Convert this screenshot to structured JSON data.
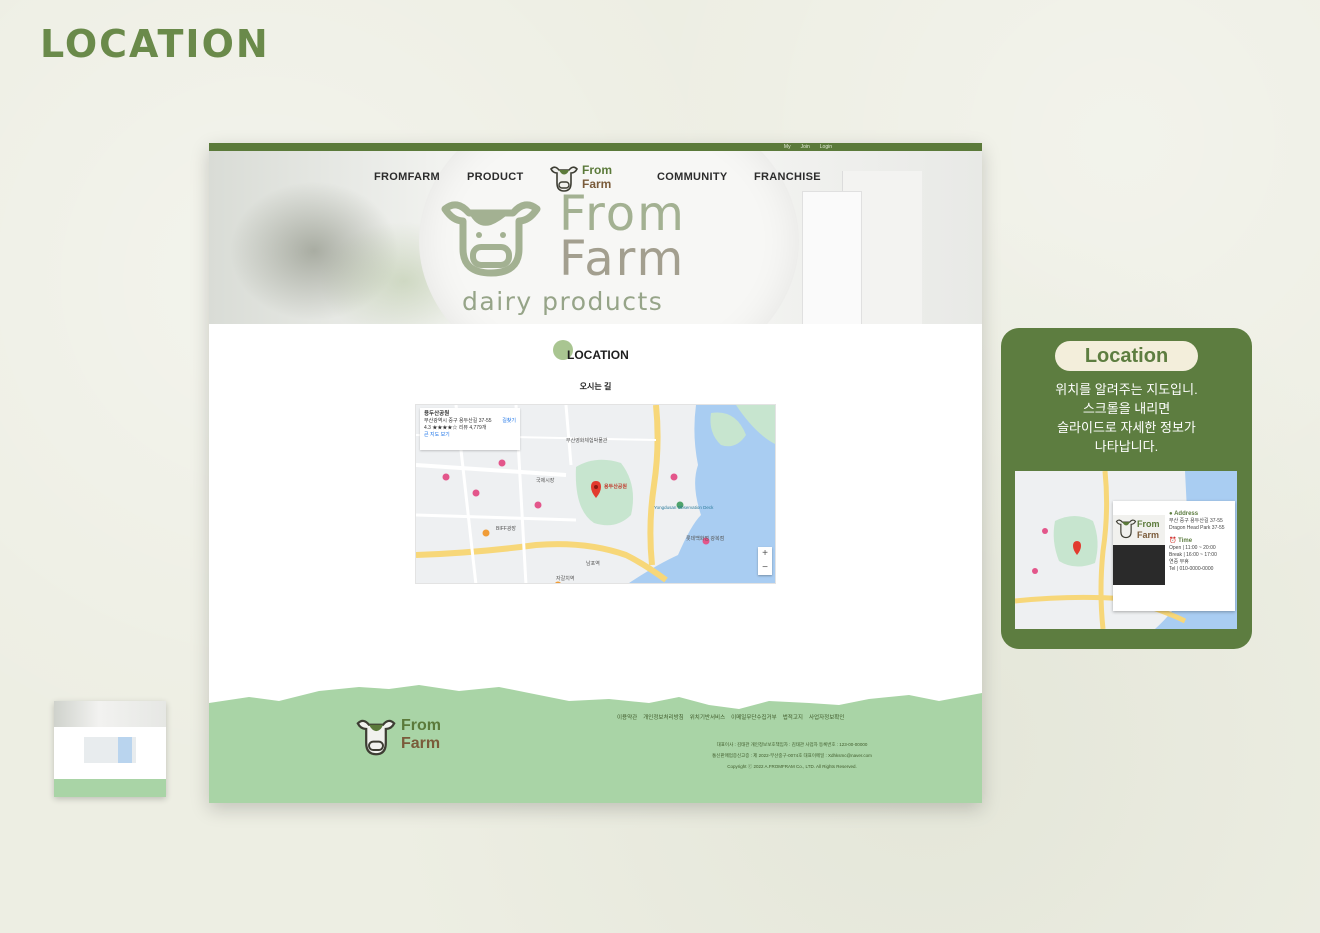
{
  "page": {
    "heading": "LOCATION"
  },
  "site": {
    "top_links": [
      "My",
      "Join",
      "Login"
    ],
    "nav": {
      "left": [
        "FROMFARM",
        "PRODUCT"
      ],
      "right": [
        "COMMUNITY",
        "FRANCHISE"
      ]
    },
    "logo": {
      "line1": "From",
      "line2": "Farm"
    },
    "hero": {
      "brand_line1": "From",
      "brand_line2": "Farm",
      "tagline": "dairy products"
    },
    "section": {
      "title": "LOCATION",
      "subtitle": "오시는 길"
    },
    "map": {
      "place_name": "용두산공원",
      "address": "부산광역시 중구 용두산길 37-55",
      "rating": "4.3 ★★★★☆  리뷰 4,779개",
      "larger_map": "큰 지도 보기",
      "directions": "길찾기",
      "zoom_in": "+",
      "zoom_out": "−",
      "labels": [
        "국제시장",
        "부산영화체험박물관",
        "Yongdusan Observation Deck",
        "BIFF광장",
        "남포역",
        "자갈치역",
        "롯데백화점 광복점",
        "용두산공원"
      ]
    },
    "footer": {
      "links": [
        "이용약관",
        "개인정보처리방침",
        "위치기반서비스",
        "이메일무단수집거부",
        "법적고지",
        "사업자정보확인"
      ],
      "info": [
        "대표이사 : 김태관  개인정보보호책임자 : 김태관  사업자 등록번호 : 123-00-00000",
        "통신판매업증신고증 : 제 2022-부산중구-0074호  대표이메일 : Xdhksmc@naver.com",
        "Copyright ⓒ 2022 A.FROMFRAM Co., LTD. All Rights Reserved."
      ]
    }
  },
  "callout": {
    "pill": "Location",
    "description": [
      "위치를 알려주는 지도입니.",
      "스크롤을 내리면",
      "슬라이드로 자세한 정보가",
      "나타납니다."
    ],
    "card": {
      "address_title": "● Address",
      "address": "부산 중구 용두산길 37-55",
      "address_sub": "Dragon Head Park 37-55",
      "time_title": "⏰ Time",
      "open": "Open  |  11:00 ~ 20:00",
      "break": "Break  |  16:00 ~ 17:00",
      "note": "연중 무휴",
      "tel": "Tel  |  010-0000-0000"
    }
  },
  "colors": {
    "brand_green": "#5b7a3a",
    "footer_green": "#a9d4a6",
    "callout_bg": "#5d7d40",
    "heading": "#6a8a4a"
  }
}
